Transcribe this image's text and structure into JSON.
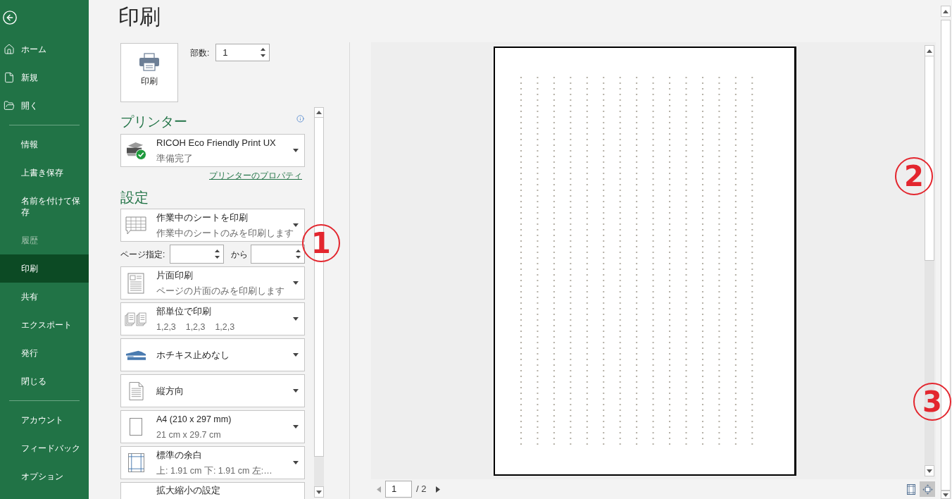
{
  "sidebar": {
    "groups": [
      {
        "items": [
          {
            "label": "ホーム",
            "selected": false,
            "disabled": false
          },
          {
            "label": "新規",
            "selected": false,
            "disabled": false
          },
          {
            "label": "開く",
            "selected": false,
            "disabled": false
          }
        ]
      },
      {
        "items": [
          {
            "label": "情報",
            "selected": false,
            "disabled": false
          },
          {
            "label": "上書き保存",
            "selected": false,
            "disabled": false
          },
          {
            "label": "名前を付けて保存",
            "selected": false,
            "disabled": false
          },
          {
            "label": "履歴",
            "selected": false,
            "disabled": true
          },
          {
            "label": "印刷",
            "selected": true,
            "disabled": false
          },
          {
            "label": "共有",
            "selected": false,
            "disabled": false
          },
          {
            "label": "エクスポート",
            "selected": false,
            "disabled": false
          },
          {
            "label": "発行",
            "selected": false,
            "disabled": false
          },
          {
            "label": "閉じる",
            "selected": false,
            "disabled": false
          }
        ]
      },
      {
        "items": [
          {
            "label": "アカウント",
            "selected": false,
            "disabled": false
          },
          {
            "label": "フィードバック",
            "selected": false,
            "disabled": false
          },
          {
            "label": "オプション",
            "selected": false,
            "disabled": false
          }
        ]
      }
    ]
  },
  "title": "印刷",
  "print_button": {
    "label": "印刷"
  },
  "copies": {
    "label": "部数:",
    "value": "1"
  },
  "printer": {
    "heading": "プリンター",
    "name": "RICOH Eco Friendly Print UX",
    "status": "準備完了",
    "link": "プリンターのプロパティ"
  },
  "settings": {
    "heading": "設定",
    "items": [
      {
        "kind": "dropdown",
        "title": "作業中のシートを印刷",
        "subtitle": "作業中のシートのみを印刷します"
      },
      {
        "kind": "page_range",
        "label": "ページ指定:",
        "to_label": "から"
      },
      {
        "kind": "dropdown",
        "title": "片面印刷",
        "subtitle": "ページの片面のみを印刷します"
      },
      {
        "kind": "dropdown",
        "title": "部単位で印刷",
        "subtitle": "1,2,3    1,2,3    1,2,3"
      },
      {
        "kind": "dropdown",
        "title": "ホチキス止めなし"
      },
      {
        "kind": "dropdown",
        "title": "縦方向"
      },
      {
        "kind": "dropdown",
        "title": "A4 (210 x 297 mm)",
        "subtitle": "21 cm x 29.7 cm"
      },
      {
        "kind": "dropdown",
        "title": "標準の余白",
        "subtitle": "上: 1.91 cm 下: 1.91 cm 左:…"
      },
      {
        "kind": "partial_dropdown",
        "title": "拡大縮小の設定"
      }
    ]
  },
  "preview": {
    "page_nav": {
      "current": "1",
      "total": "/ 2"
    },
    "view_buttons": [
      {
        "selected": false
      },
      {
        "selected": true
      }
    ]
  },
  "annotations": [
    {
      "label": "1"
    },
    {
      "label": "2"
    },
    {
      "label": "3"
    }
  ]
}
